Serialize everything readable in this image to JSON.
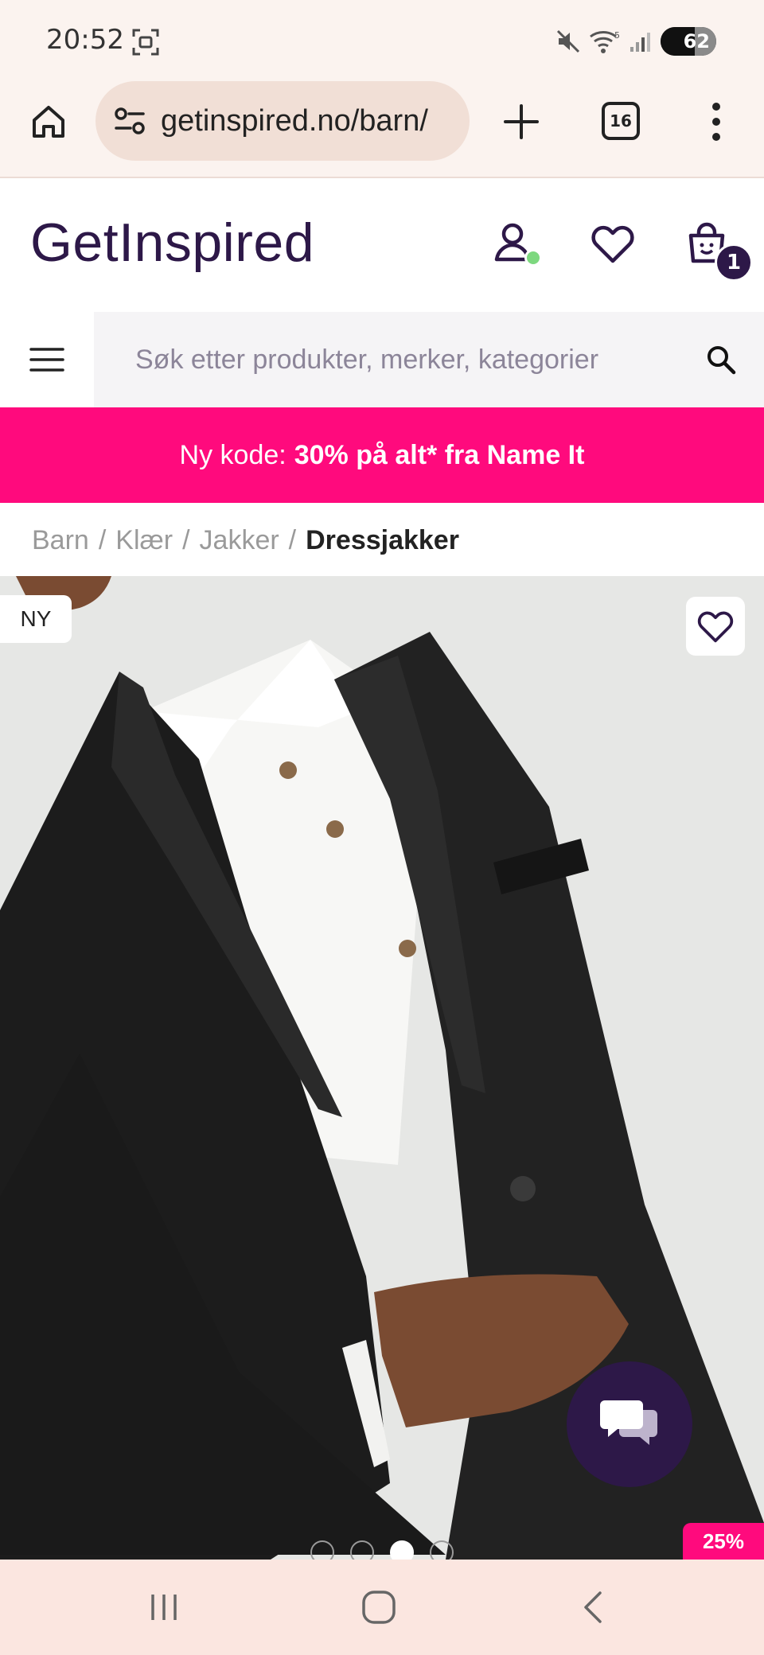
{
  "status_bar": {
    "time": "20:52",
    "battery": "62",
    "icons": [
      "screenshot-icon",
      "mute-icon",
      "wifi-icon",
      "signal-icon",
      "battery-icon"
    ]
  },
  "browser": {
    "url": "getinspired.no/barn/",
    "tab_count": "16"
  },
  "header": {
    "logo": "GetInspired",
    "cart_count": "1"
  },
  "search": {
    "placeholder": "Søk etter produkter, merker, kategorier"
  },
  "promo": {
    "prefix": "Ny kode:",
    "highlight": "30% på alt* fra Name It",
    "color": "#ff0a7d"
  },
  "breadcrumb": {
    "items": [
      "Barn",
      "Klær",
      "Jakker"
    ],
    "current": "Dressjakker"
  },
  "product": {
    "badge_new": "NY",
    "discount": "25%",
    "gallery_index": 3,
    "gallery_total": 4
  },
  "colors": {
    "brand": "#2d1848",
    "accent": "#ff0a7d",
    "chrome": "#fbf3ef"
  }
}
